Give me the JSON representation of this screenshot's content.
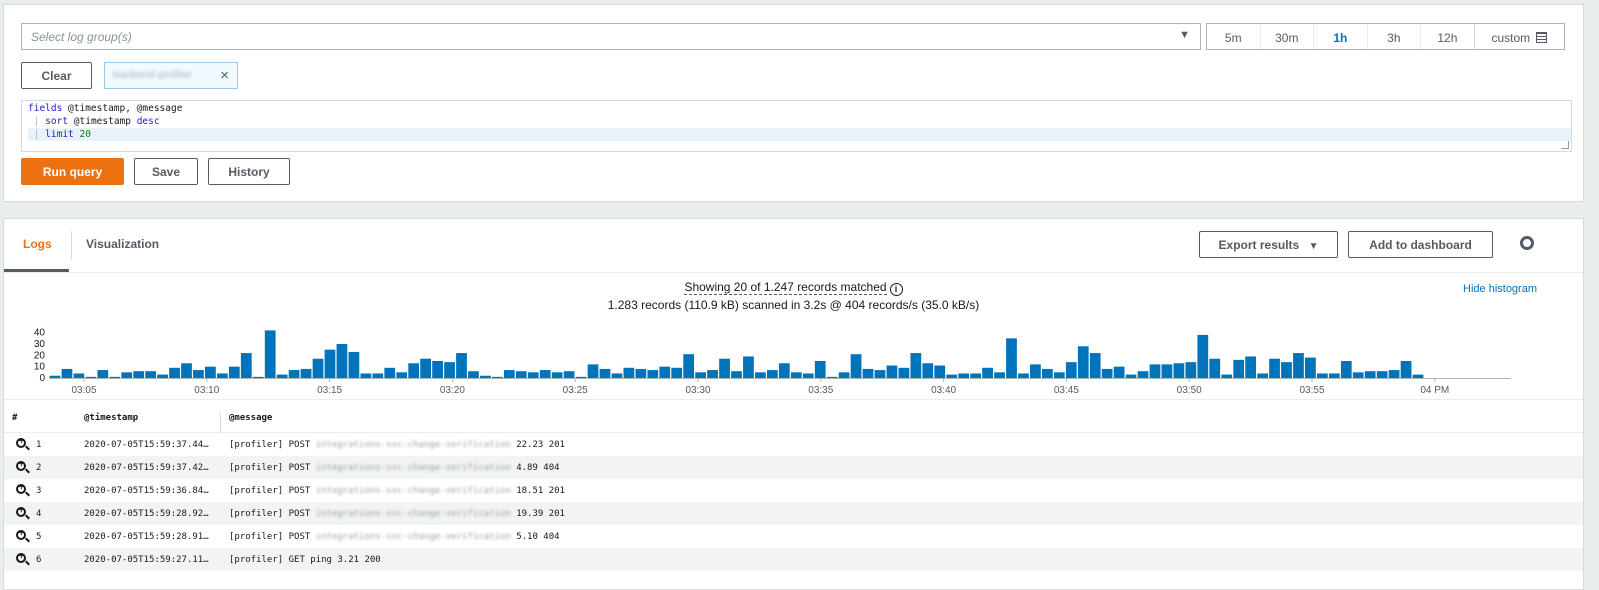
{
  "query_bar": {
    "log_group_placeholder": "Select log group(s)",
    "caret": "▼",
    "time_ranges": [
      {
        "label": "5m",
        "active": false
      },
      {
        "label": "30m",
        "active": false
      },
      {
        "label": "1h",
        "active": true
      },
      {
        "label": "3h",
        "active": false
      },
      {
        "label": "12h",
        "active": false
      }
    ],
    "custom_label": "custom",
    "clear_label": "Clear",
    "selected_group": "backend-profiler",
    "remove_icon": "×"
  },
  "editor": {
    "line1_kw": "fields",
    "line1_rest": " @timestamp, @message",
    "line2_pipe": " | ",
    "line2_kw": "sort",
    "line2_rest": " @timestamp ",
    "line2_kw2": "desc",
    "line3_pipe": " | ",
    "line3_kw": "limit",
    "line3_num": " 20"
  },
  "actions": {
    "run_label": "Run query",
    "save_label": "Save",
    "history_label": "History"
  },
  "results": {
    "tabs": {
      "logs": "Logs",
      "visualization": "Visualization"
    },
    "export_label": "Export results",
    "dashboard_label": "Add to dashboard",
    "showing": "Showing 20 of 1.247 records matched",
    "info_glyph": "i",
    "scanned": "1.283 records (110.9 kB) scanned in 3.2s @ 404 records/s (35.0 kB/s)",
    "hide_histogram": "Hide histogram"
  },
  "colors": {
    "accent": "#ec7211",
    "bar": "#0073bb",
    "link": "#0073bb"
  },
  "chart_data": {
    "type": "bar",
    "x_ticks": [
      "03:05",
      "03:10",
      "03:15",
      "03:20",
      "03:25",
      "03:30",
      "03:35",
      "03:40",
      "03:45",
      "03:50",
      "03:55",
      "04 PM"
    ],
    "y_ticks": [
      "0",
      "10",
      "20",
      "30",
      "40"
    ],
    "ylim": [
      0,
      45
    ],
    "values": [
      2,
      8,
      4,
      1,
      7,
      1,
      5,
      6,
      6,
      3,
      9,
      13,
      7,
      10,
      4,
      10,
      22,
      1,
      42,
      3,
      7,
      8,
      17,
      25,
      30,
      23,
      4,
      4,
      9,
      5,
      13,
      17,
      15,
      14,
      22,
      6,
      2,
      1,
      7,
      6,
      5,
      7,
      5,
      6,
      1,
      12,
      8,
      4,
      9,
      8,
      7,
      10,
      9,
      21,
      5,
      7,
      17,
      6,
      19,
      5,
      7,
      13,
      5,
      4,
      15,
      1,
      5,
      21,
      8,
      7,
      11,
      9,
      22,
      13,
      11,
      3,
      4,
      4,
      9,
      5,
      35,
      4,
      12,
      8,
      5,
      14,
      28,
      22,
      8,
      10,
      3,
      6,
      12,
      12,
      13,
      14,
      38,
      17,
      3,
      16,
      19,
      4,
      17,
      14,
      22,
      18,
      4,
      4,
      15,
      5,
      6,
      6,
      7,
      15,
      3
    ]
  },
  "table": {
    "headers": [
      "#",
      "@timestamp",
      "@message"
    ],
    "rows": [
      {
        "n": "1",
        "ts": "2020-07-05T15:59:37.44…",
        "prefix": "[profiler] POST",
        "path": "integrations-svc-change-verification",
        "suffix": "22.23 201"
      },
      {
        "n": "2",
        "ts": "2020-07-05T15:59:37.42…",
        "prefix": "[profiler] POST",
        "path": "integrations-svc-change-verification",
        "suffix": "4.89 404"
      },
      {
        "n": "3",
        "ts": "2020-07-05T15:59:36.84…",
        "prefix": "[profiler] POST",
        "path": "integrations-svc-change-verification",
        "suffix": "18.51 201"
      },
      {
        "n": "4",
        "ts": "2020-07-05T15:59:28.92…",
        "prefix": "[profiler] POST",
        "path": "integrations-svc-change-verification",
        "suffix": "19.39 201"
      },
      {
        "n": "5",
        "ts": "2020-07-05T15:59:28.91…",
        "prefix": "[profiler] POST",
        "path": "integrations-svc-change-verification",
        "suffix": "5.10 404"
      },
      {
        "n": "6",
        "ts": "2020-07-05T15:59:27.11…",
        "prefix": "[profiler] GET ping 3.21 200",
        "path": "",
        "suffix": ""
      }
    ]
  }
}
